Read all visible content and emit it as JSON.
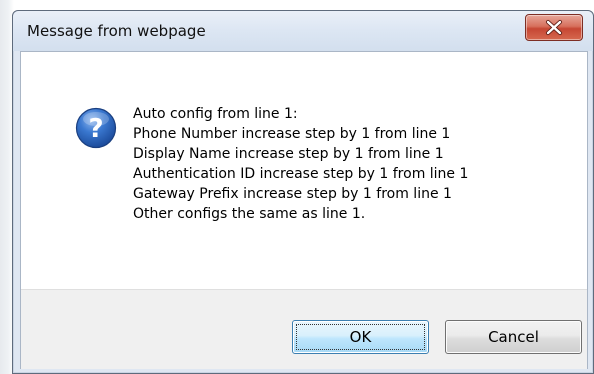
{
  "window": {
    "title": "Message from webpage",
    "close_icon": "close-x-icon"
  },
  "message": {
    "icon": "question-mark-icon",
    "lines": [
      "Auto config from line 1:",
      "Phone Number increase step by 1 from line 1",
      "Display Name increase step by 1 from line 1",
      "Authentication ID increase step by 1 from line 1",
      "Gateway Prefix increase step by 1 from line 1",
      "Other configs the same as line 1."
    ]
  },
  "buttons": {
    "ok_label": "OK",
    "cancel_label": "Cancel"
  },
  "colors": {
    "close_button": "#c64734",
    "question_icon": "#2a63b8",
    "ok_button_border": "#3c7fb1"
  }
}
